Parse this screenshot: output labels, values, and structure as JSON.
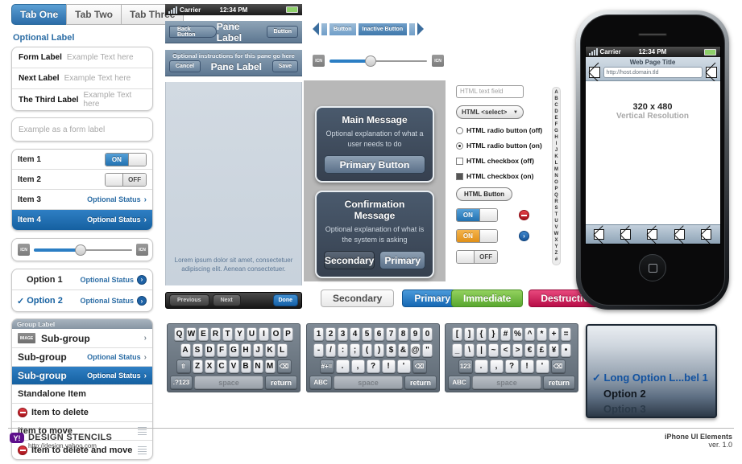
{
  "meta": {
    "title": "iPhone UI Elements",
    "version": "ver. 1.0",
    "footer_brand": "DESIGN STENCILS",
    "footer_url": "http://design.yahoo.com",
    "footer_logo_text": "Y!"
  },
  "colors": {
    "accent_blue": "#2b6ca8",
    "selected_blue": "#1560a0",
    "status_link": "#2c6da5",
    "green": "#59a72f",
    "red": "#b80d47",
    "amber": "#e08f17",
    "brand_purple": "#5d0f8b"
  },
  "tabs": [
    {
      "label": "Tab One",
      "active": true
    },
    {
      "label": "Tab Two",
      "active": false
    },
    {
      "label": "Tab Three",
      "active": false
    }
  ],
  "optional_label": "Optional Label",
  "form_rows": [
    {
      "label": "Form Label",
      "placeholder": "Example Text here",
      "value": ""
    },
    {
      "label": "Next Label",
      "placeholder": "Example Text here",
      "value": ""
    },
    {
      "label": "The Third Label",
      "placeholder": "Example Text here",
      "value": ""
    }
  ],
  "single_field": {
    "placeholder": "Example as a form label",
    "value": ""
  },
  "item_list": [
    {
      "label": "Item 1",
      "control": "toggle-on",
      "toggle_on_label": "ON"
    },
    {
      "label": "Item 2",
      "control": "toggle-off",
      "toggle_off_label": "OFF"
    },
    {
      "label": "Item 3",
      "control": "status",
      "status": "Optional Status",
      "chevron": "›",
      "selected": false
    },
    {
      "label": "Item 4",
      "control": "status",
      "status": "Optional Status",
      "chevron": "›",
      "selected": true
    }
  ],
  "slider_left": {
    "min_icon": "ICN",
    "max_icon": "ICN",
    "value": 45
  },
  "option_list": [
    {
      "label": "Option 1",
      "status": "Optional Status",
      "checked": false,
      "badge": "›"
    },
    {
      "label": "Option 2",
      "status": "Optional Status",
      "checked": true,
      "badge": "›",
      "check": "✓"
    }
  ],
  "group_list": {
    "header": "Group Label",
    "rows": [
      {
        "label": "Sub-group",
        "image_chip": "IMAGE",
        "chevron": "›",
        "status": "",
        "selected": false
      },
      {
        "label": "Sub-group",
        "status": "Optional Status",
        "chevron": "›",
        "selected": false
      },
      {
        "label": "Sub-group",
        "status": "Optional Status",
        "chevron": "›",
        "selected": true
      },
      {
        "label": "Standalone Item",
        "status": "",
        "selected": false
      },
      {
        "label": "Item to delete",
        "delete": true,
        "selected": false
      },
      {
        "label": "Item to move",
        "grip": true,
        "selected": false
      },
      {
        "label": "Item to delete and move",
        "delete": true,
        "grip": true,
        "selected": false
      }
    ]
  },
  "pane": {
    "status_bar": {
      "carrier": "Carrier",
      "time": "12:34 PM"
    },
    "navbar_1": {
      "back": "Back Button",
      "title": "Pane Label",
      "right": "Button"
    },
    "navbar_2": {
      "instructions": "Optional instructions for this pane go here",
      "left": "Cancel",
      "title": "Pane Label",
      "right": "Save"
    },
    "body_text": "Lorem ipsum dolor sit amet, consectetuer adipiscing elit. Aenean consectetuer.",
    "bottom_bar": {
      "previous": "Previous",
      "next": "Next",
      "done": "Done"
    }
  },
  "segmented": {
    "button_label": "Button",
    "inactive_label": "Inactive Button"
  },
  "slider_top": {
    "min_icon": "ICN",
    "max_icon": "ICN",
    "value": 38
  },
  "dialogs": [
    {
      "title": "Main Message",
      "body": "Optional explanation of what a user needs to do",
      "buttons": [
        {
          "label": "Primary Button",
          "style": "primary"
        }
      ]
    },
    {
      "title": "Confirmation Message",
      "body": "Optional explanation of what is the system is asking",
      "buttons": [
        {
          "label": "Secondary",
          "style": "secondary"
        },
        {
          "label": "Primary",
          "style": "primary"
        }
      ]
    }
  ],
  "html_controls": {
    "text_field": {
      "placeholder": "HTML text field",
      "value": ""
    },
    "select": {
      "value": "HTML <select>",
      "caret": "▼"
    },
    "radio_off": "HTML radio button (off)",
    "radio_on": "HTML radio button (on)",
    "checkbox_off": "HTML checkbox (off)",
    "checkbox_on": "HTML checkbox (on)",
    "button": "HTML Button",
    "toggle_blue": {
      "on_label": "ON"
    },
    "toggle_amber": {
      "on_label": "ON"
    },
    "toggle_off": {
      "off_label": "OFF"
    },
    "badge_blue_glyph": "›"
  },
  "alpha_index": [
    "A",
    "B",
    "C",
    "D",
    "E",
    "F",
    "G",
    "H",
    "I",
    "J",
    "K",
    "L",
    "M",
    "N",
    "O",
    "P",
    "Q",
    "R",
    "S",
    "T",
    "U",
    "V",
    "W",
    "X",
    "Y",
    "Z",
    "#"
  ],
  "buttons_row": [
    {
      "label": "Secondary",
      "style": "secondary"
    },
    {
      "label": "Primary",
      "style": "primary"
    },
    {
      "label": "Immediate",
      "style": "green"
    },
    {
      "label": "Destructive",
      "style": "red"
    }
  ],
  "device": {
    "status_bar": {
      "carrier": "Carrier",
      "time": "12:34 PM"
    },
    "page_title": "Web Page Title",
    "url_value": "http://host.domain.tld",
    "resolution": "320 x 480",
    "resolution_note": "Vertical Resolution",
    "toolbar_item_count": 5
  },
  "keyboards": [
    {
      "name": "letters",
      "rows": [
        [
          "Q",
          "W",
          "E",
          "R",
          "T",
          "Y",
          "U",
          "I",
          "O",
          "P"
        ],
        [
          "A",
          "S",
          "D",
          "F",
          "G",
          "H",
          "J",
          "K",
          "L"
        ],
        [
          "⇧",
          "Z",
          "X",
          "C",
          "V",
          "B",
          "N",
          "M",
          "⌫"
        ]
      ],
      "bottom": {
        "mode": ".?123",
        "space": "space",
        "return": "return"
      }
    },
    {
      "name": "numbers",
      "rows": [
        [
          "1",
          "2",
          "3",
          "4",
          "5",
          "6",
          "7",
          "8",
          "9",
          "0"
        ],
        [
          "-",
          "/",
          ":",
          ";",
          "(",
          ")",
          "$",
          "&",
          "@",
          "\""
        ],
        [
          "#+=",
          ".",
          ",",
          "?",
          "!",
          "'",
          "⌫"
        ]
      ],
      "bottom": {
        "mode": "ABC",
        "space": "space",
        "return": "return"
      }
    },
    {
      "name": "symbols",
      "rows": [
        [
          "[",
          "]",
          "{",
          "}",
          "#",
          "%",
          "^",
          "*",
          "+",
          "="
        ],
        [
          "_",
          "\\",
          "|",
          "~",
          "<",
          ">",
          "€",
          "£",
          "¥",
          "•"
        ],
        [
          "123",
          ".",
          ",",
          "?",
          "!",
          "'",
          "⌫"
        ]
      ],
      "bottom": {
        "mode": "ABC",
        "space": "space",
        "return": "return"
      }
    }
  ],
  "select_popup": {
    "options": [
      {
        "label": "Long Option L...bel 1",
        "selected": true,
        "check": "✓"
      },
      {
        "label": "Option 2",
        "selected": false
      },
      {
        "label": "Option 3",
        "selected": false
      }
    ]
  }
}
